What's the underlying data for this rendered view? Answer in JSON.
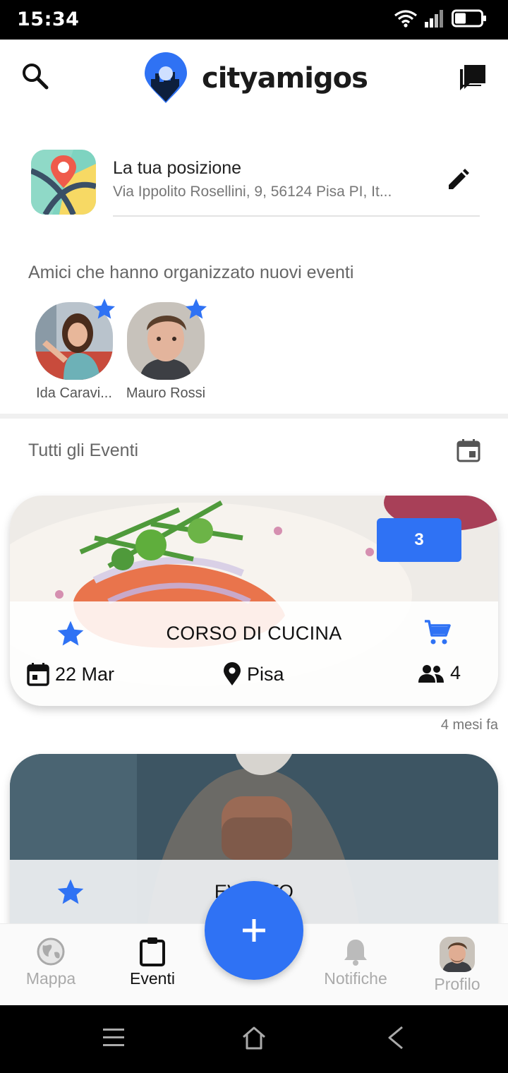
{
  "status_bar": {
    "time": "15:34"
  },
  "header": {
    "brand": "cityamigos"
  },
  "location": {
    "title": "La tua posizione",
    "address": "Via Ippolito Rosellini, 9, 56124 Pisa PI, It..."
  },
  "friends": {
    "title": "Amici che hanno organizzato nuovi eventi",
    "items": [
      {
        "name": "Ida Caravi..."
      },
      {
        "name": "Mauro Rossi"
      }
    ]
  },
  "events": {
    "title": "Tutti gli Eventi",
    "items": [
      {
        "badge": "3",
        "title": "CORSO DI CUCINA",
        "date": "22 Mar",
        "place": "Pisa",
        "participants": "4",
        "ago": "4 mesi fa"
      },
      {
        "title": "EVENTO"
      }
    ]
  },
  "bottom_nav": {
    "items": [
      {
        "label": "Mappa",
        "icon": "globe-icon",
        "active": false
      },
      {
        "label": "Eventi",
        "icon": "clipboard-icon",
        "active": true
      },
      {
        "label": "Notifiche",
        "icon": "bell-icon",
        "active": false
      },
      {
        "label": "Profilo",
        "icon": "avatar",
        "active": false
      }
    ],
    "fab_icon": "plus-icon"
  },
  "colors": {
    "accent": "#2f72f4",
    "text": "#222222",
    "muted": "#777777"
  }
}
